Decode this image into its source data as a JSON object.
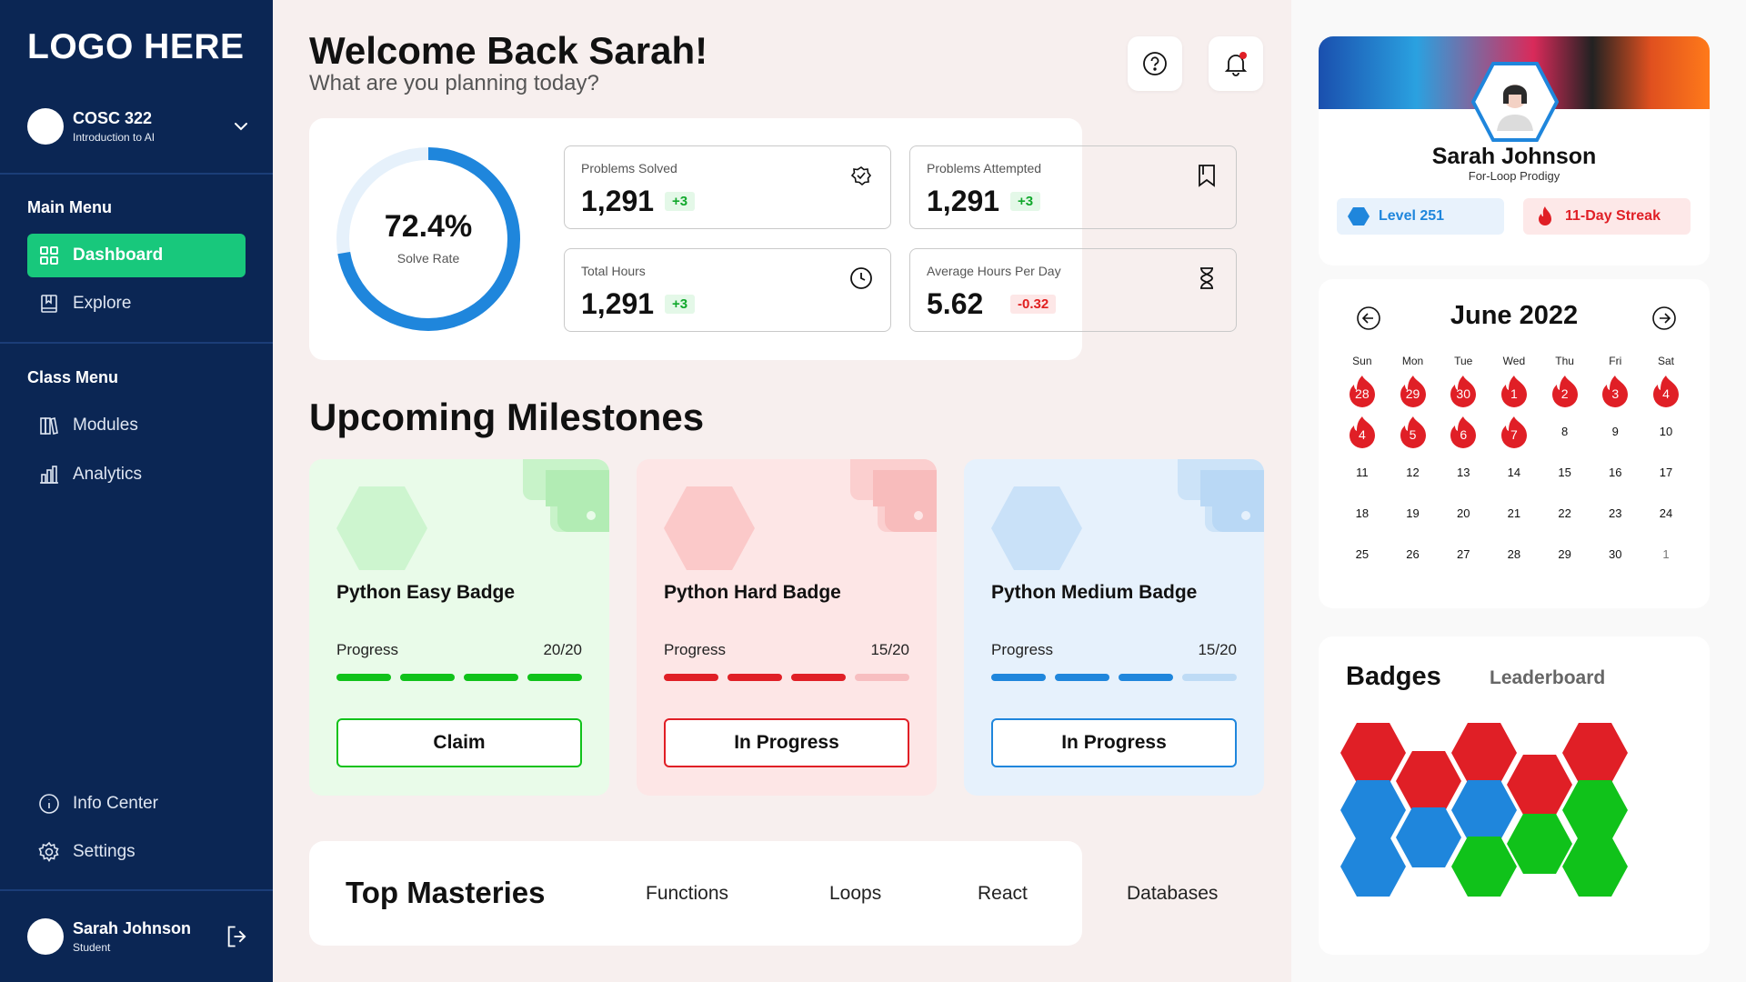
{
  "sidebar": {
    "logo": "LOGO HERE",
    "course": {
      "code": "COSC 322",
      "name": "Introduction to AI"
    },
    "main_menu_title": "Main Menu",
    "main_items": [
      {
        "label": "Dashboard",
        "icon": "grid-icon"
      },
      {
        "label": "Explore",
        "icon": "book-icon"
      }
    ],
    "class_menu_title": "Class Menu",
    "class_items": [
      {
        "label": "Modules",
        "icon": "books-icon"
      },
      {
        "label": "Analytics",
        "icon": "bar-chart-icon"
      }
    ],
    "bottom_items": [
      {
        "label": "Info Center",
        "icon": "info-icon"
      },
      {
        "label": "Settings",
        "icon": "gear-icon"
      }
    ],
    "user": {
      "name": "Sarah Johnson",
      "role": "Student"
    }
  },
  "header": {
    "welcome": "Welcome Back Sarah!",
    "subtitle": "What are you planning today?"
  },
  "stats": {
    "solve_rate": "72.4%",
    "solve_rate_value": 0.724,
    "solve_rate_label": "Solve Rate",
    "cards": [
      {
        "label": "Problems Solved",
        "value": "1,291",
        "delta": "+3",
        "icon": "badge-check-icon"
      },
      {
        "label": "Problems Attempted",
        "value": "1,291",
        "delta": "+3",
        "icon": "bookmark-icon"
      },
      {
        "label": "Total Hours",
        "value": "1,291",
        "delta": "+3",
        "icon": "clock-icon"
      },
      {
        "label": "Average Hours Per Day",
        "value": "5.62",
        "delta": "-0.32",
        "icon": "hourglass-icon"
      }
    ]
  },
  "milestones": {
    "title": "Upcoming Milestones",
    "items": [
      {
        "title": "Python Easy Badge",
        "progress_label": "Progress",
        "progress": "20/20",
        "done": 4,
        "total": 4,
        "button": "Claim",
        "color": "#10c21a"
      },
      {
        "title": "Python Hard Badge",
        "progress_label": "Progress",
        "progress": "15/20",
        "done": 3,
        "total": 4,
        "button": "In Progress",
        "color": "#e01f26"
      },
      {
        "title": "Python Medium Badge",
        "progress_label": "Progress",
        "progress": "15/20",
        "done": 3,
        "total": 4,
        "button": "In Progress",
        "color": "#1f86dc"
      }
    ]
  },
  "masteries": {
    "title": "Top Masteries",
    "items": [
      "Functions",
      "Loops",
      "React",
      "Databases"
    ]
  },
  "profile": {
    "name": "Sarah Johnson",
    "title": "For-Loop Prodigy",
    "level": "Level 251",
    "streak": "11-Day Streak"
  },
  "calendar": {
    "title": "June 2022",
    "weekdays": [
      "Sun",
      "Mon",
      "Tue",
      "Wed",
      "Thu",
      "Fri",
      "Sat"
    ],
    "weeks": [
      [
        {
          "d": "28",
          "f": true
        },
        {
          "d": "29",
          "f": true
        },
        {
          "d": "30",
          "f": true
        },
        {
          "d": "1",
          "f": true
        },
        {
          "d": "2",
          "f": true
        },
        {
          "d": "3",
          "f": true
        },
        {
          "d": "4",
          "f": true
        }
      ],
      [
        {
          "d": "4",
          "f": true
        },
        {
          "d": "5",
          "f": true
        },
        {
          "d": "6",
          "f": true
        },
        {
          "d": "7",
          "f": true
        },
        {
          "d": "8"
        },
        {
          "d": "9"
        },
        {
          "d": "10"
        }
      ],
      [
        {
          "d": "11"
        },
        {
          "d": "12"
        },
        {
          "d": "13"
        },
        {
          "d": "14"
        },
        {
          "d": "15"
        },
        {
          "d": "16"
        },
        {
          "d": "17"
        }
      ],
      [
        {
          "d": "18"
        },
        {
          "d": "19"
        },
        {
          "d": "20"
        },
        {
          "d": "21"
        },
        {
          "d": "22"
        },
        {
          "d": "23"
        },
        {
          "d": "24"
        }
      ],
      [
        {
          "d": "25"
        },
        {
          "d": "26"
        },
        {
          "d": "27"
        },
        {
          "d": "28"
        },
        {
          "d": "29"
        },
        {
          "d": "30"
        },
        {
          "d": "1",
          "m": true
        }
      ]
    ]
  },
  "badges": {
    "tab_badges": "Badges",
    "tab_leaderboard": "Leaderboard",
    "colors": {
      "red": "#e01f26",
      "blue": "#1f86dc",
      "green": "#10c21a"
    }
  }
}
